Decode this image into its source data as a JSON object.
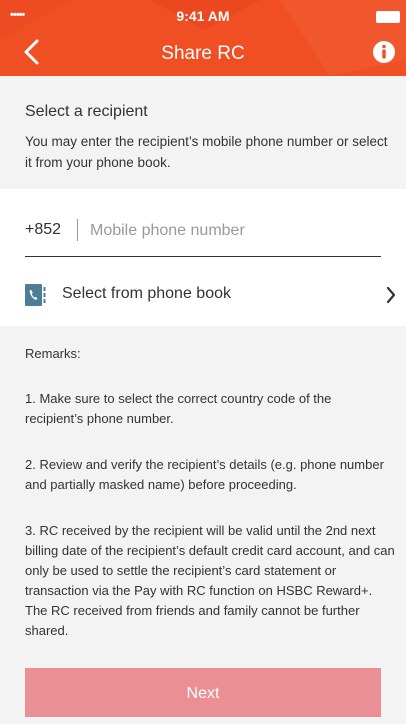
{
  "status_bar": {
    "time": "9:41 AM",
    "signal": "•••••"
  },
  "header": {
    "title": "Share RC",
    "back_icon": "back-arrow-icon",
    "info_icon": "info-icon",
    "accent": "#f04e23"
  },
  "intro": {
    "heading": "Select a recipient",
    "description": "You may enter the recipient’s mobile phone number or select it from your phone book."
  },
  "form": {
    "country_code": "+852",
    "phone_placeholder": "Mobile phone number",
    "phone_value": "",
    "phonebook_label": "Select from phone book"
  },
  "remarks": {
    "title": "Remarks:",
    "items": [
      "1. Make sure to select the correct country code of the recipient’s phone number.",
      "2. Review and verify the recipient’s details (e.g. phone number and partially masked name) before proceeding.",
      "3. RC received by the recipient will be valid until the 2nd next billing date of the recipient’s default credit card account, and can only be used to settle the recipient’s card statement or transaction via the Pay with RC function on HSBC Reward+.  The RC received from friends and family cannot be further shared."
    ]
  },
  "footer": {
    "next_label": "Next",
    "next_color": "#ea8f94"
  }
}
